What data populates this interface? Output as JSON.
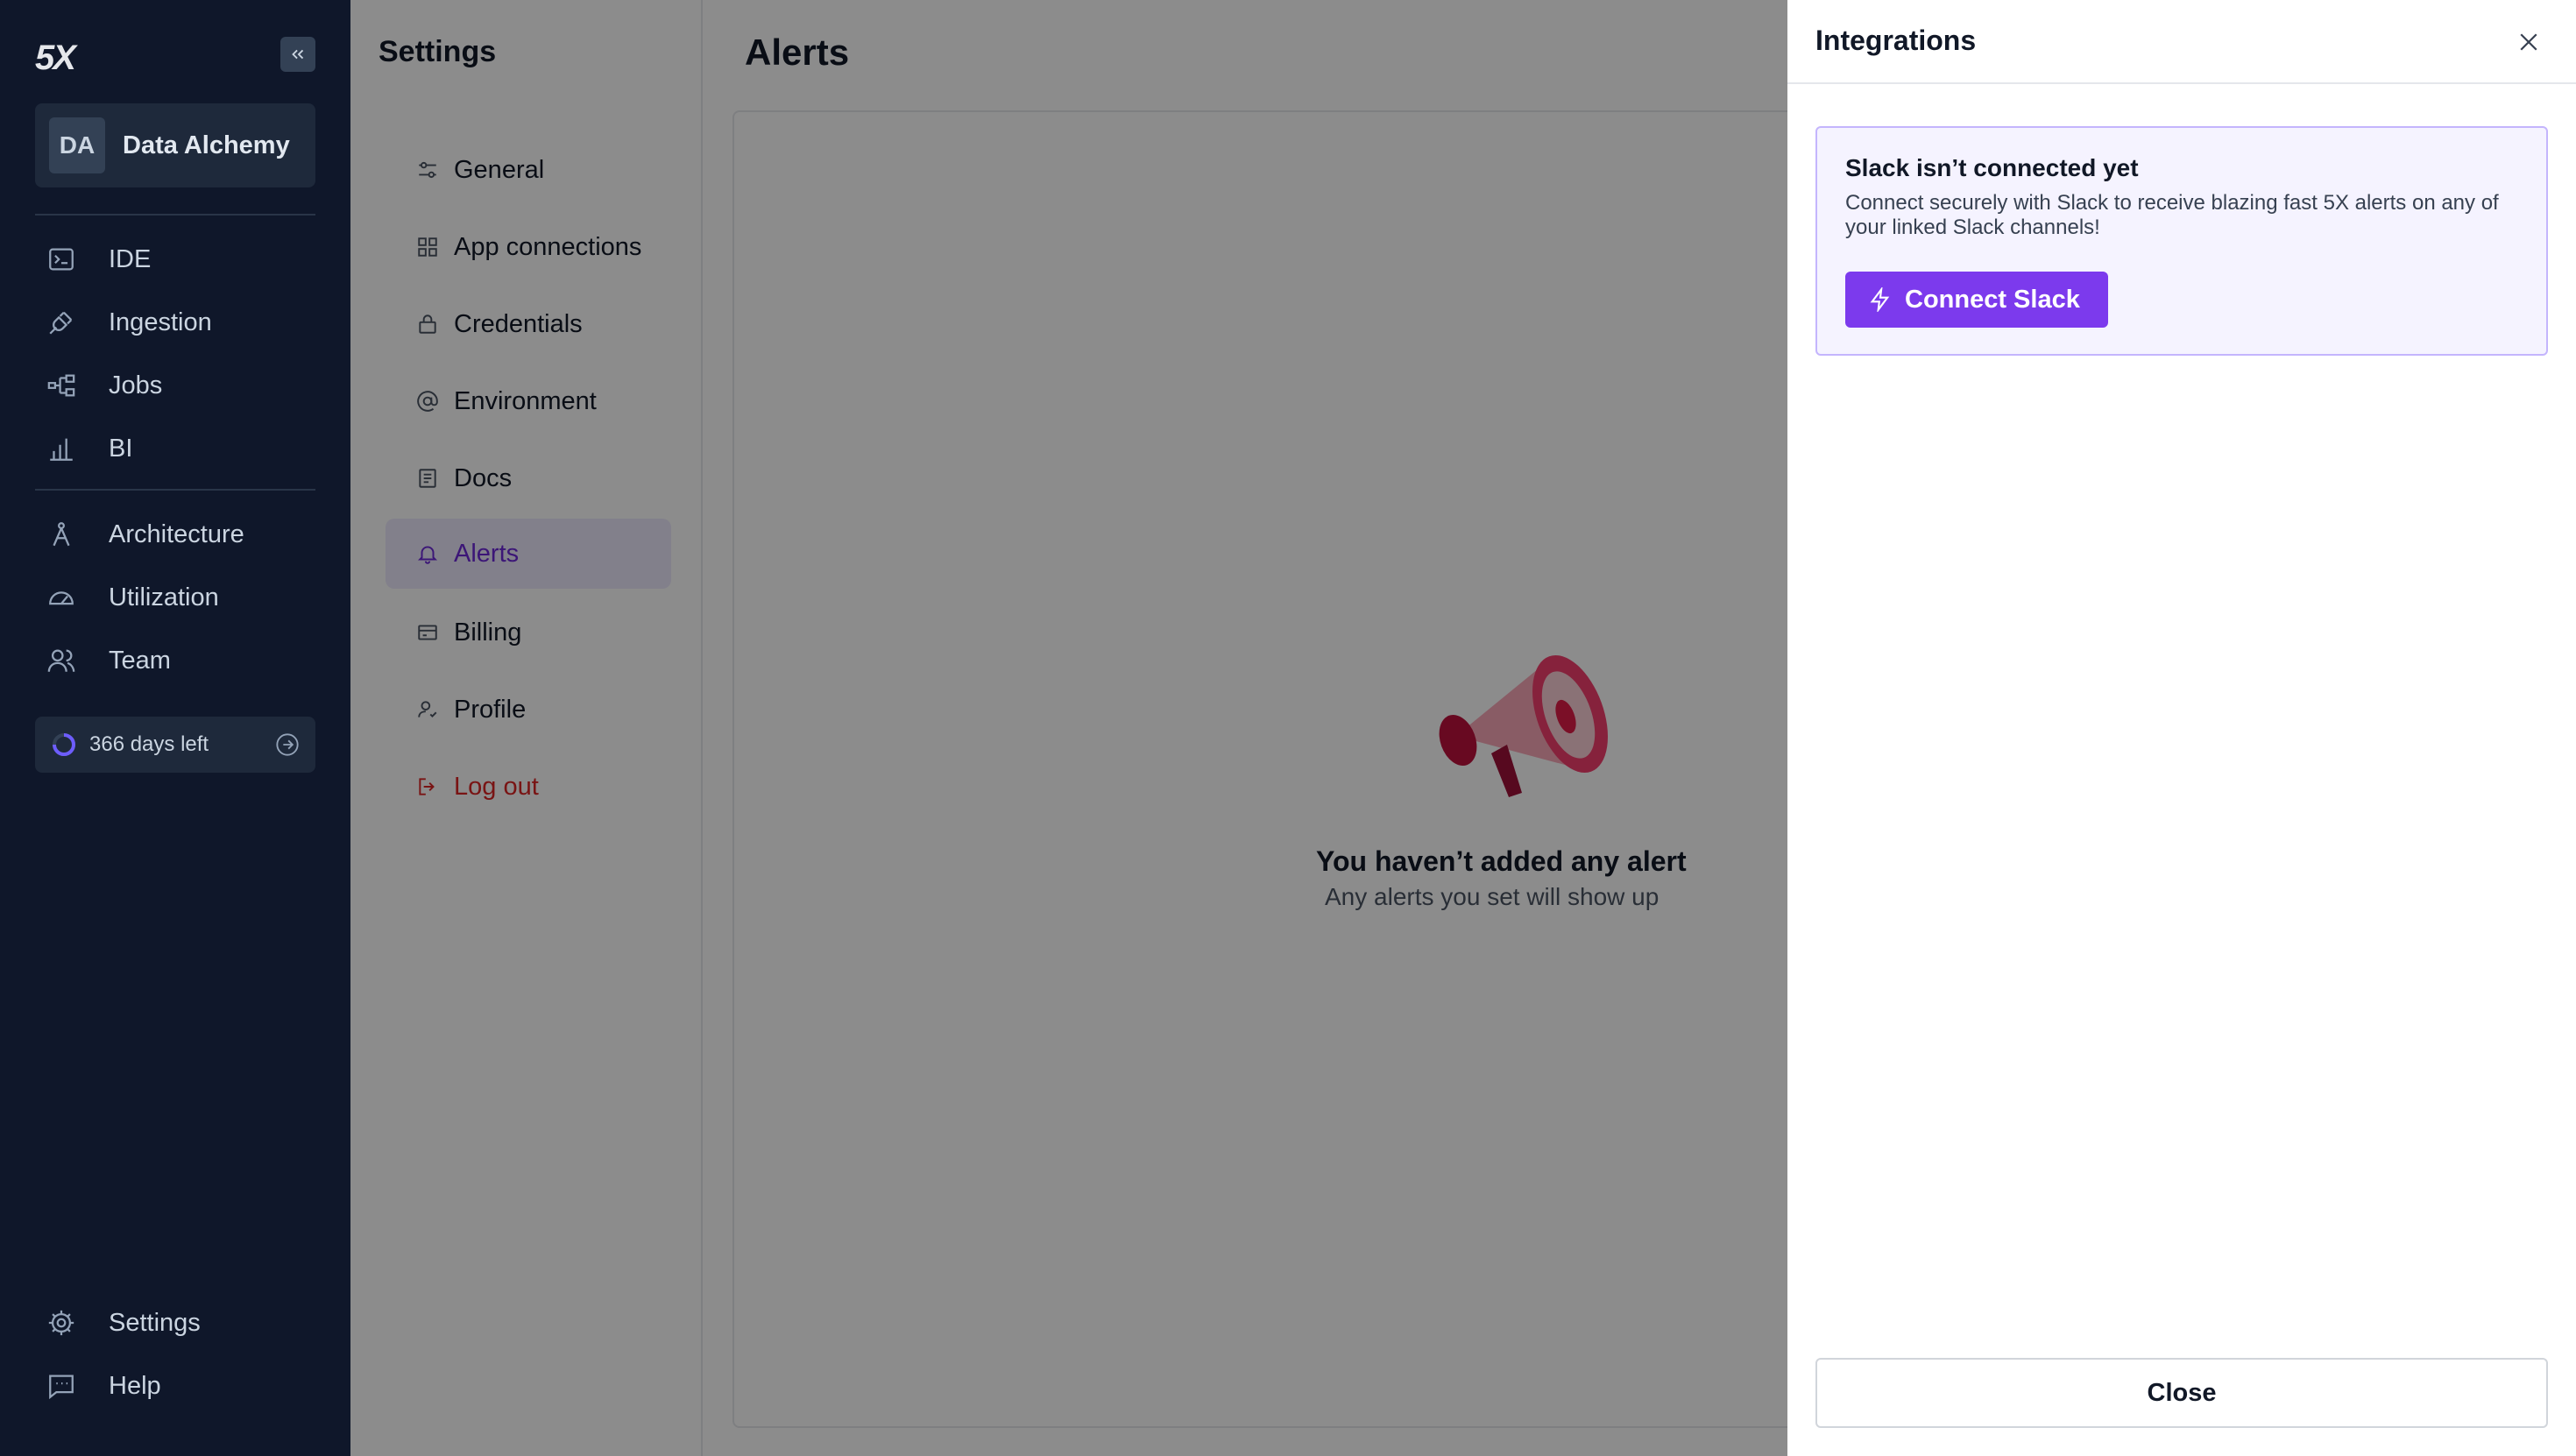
{
  "nav": {
    "logo": "5X",
    "workspace": {
      "initials": "DA",
      "name": "Data Alchemy"
    },
    "items": [
      {
        "label": "IDE",
        "icon": "terminal-icon"
      },
      {
        "label": "Ingestion",
        "icon": "plug-icon"
      },
      {
        "label": "Jobs",
        "icon": "workflow-icon"
      },
      {
        "label": "BI",
        "icon": "bar-chart-icon"
      },
      {
        "label": "Architecture",
        "icon": "compass-icon"
      },
      {
        "label": "Utilization",
        "icon": "gauge-icon"
      },
      {
        "label": "Team",
        "icon": "users-icon"
      }
    ],
    "trial": {
      "label": "366 days left"
    },
    "bottom": [
      {
        "label": "Settings",
        "icon": "gear-icon"
      },
      {
        "label": "Help",
        "icon": "message-icon"
      }
    ]
  },
  "settings": {
    "title": "Settings",
    "items": [
      {
        "label": "General",
        "icon": "sliders-icon"
      },
      {
        "label": "App connections",
        "icon": "grid-icon"
      },
      {
        "label": "Credentials",
        "icon": "lock-icon"
      },
      {
        "label": "Environment",
        "icon": "at-sign-icon"
      },
      {
        "label": "Docs",
        "icon": "document-icon"
      },
      {
        "label": "Alerts",
        "icon": "bell-icon",
        "active": true
      },
      {
        "label": "Billing",
        "icon": "receipt-icon"
      },
      {
        "label": "Profile",
        "icon": "user-check-icon"
      },
      {
        "label": "Log out",
        "icon": "logout-icon"
      }
    ]
  },
  "main": {
    "title": "Alerts",
    "empty": {
      "title": "You haven’t added any alert",
      "subtitle": "Any alerts you set will show up"
    }
  },
  "drawer": {
    "title": "Integrations",
    "slack": {
      "title": "Slack isn’t connected yet",
      "description": "Connect securely with Slack to receive blazing fast 5X alerts on any of your linked Slack channels!",
      "button": "Connect Slack"
    },
    "close_label": "Close"
  },
  "colors": {
    "nav_bg": "#0f172a",
    "accent": "#7c3aed",
    "active_bg": "#ede9fe",
    "danger": "#dc2626"
  }
}
